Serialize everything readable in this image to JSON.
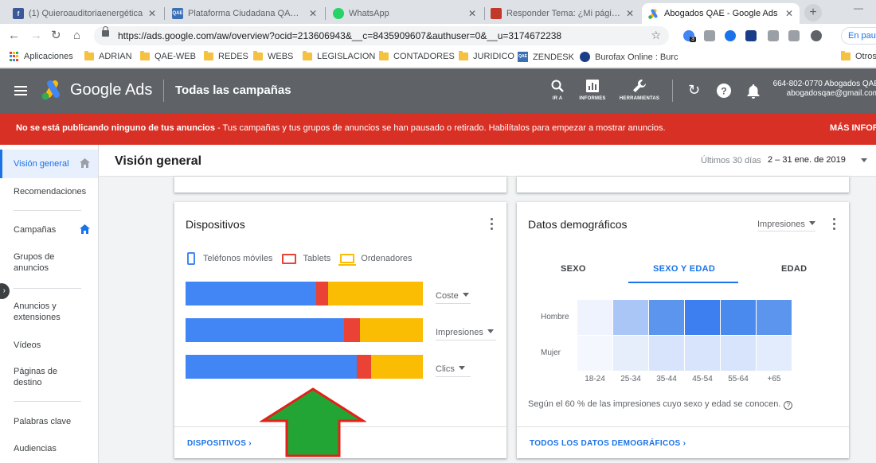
{
  "browser": {
    "tabs": [
      {
        "title": "(1) Quieroauditoriaenergética",
        "favicon_color": "#3b5998",
        "favicon_text": "f",
        "active": false
      },
      {
        "title": "Plataforma Ciudadana QAE - Ag",
        "favicon_color": "#3b6fb6",
        "favicon_text": "QAE",
        "active": false
      },
      {
        "title": "WhatsApp",
        "favicon_color": "#25d366",
        "favicon_text": "",
        "active": false
      },
      {
        "title": "Responder Tema: ¿Mi página no",
        "favicon_color": "#c0392b",
        "favicon_text": "",
        "active": false
      },
      {
        "title": "Abogados QAE - Google Ads",
        "favicon_color": "#fbbc04",
        "favicon_text": "",
        "active": true
      }
    ],
    "url": "https://ads.google.com/aw/overview?ocid=213606943&__c=8435909607&authuser=0&__u=3174672238",
    "profile_text": "En paus",
    "extension_badge": "3",
    "bookmarks": [
      {
        "label": "Aplicaciones",
        "kind": "apps"
      },
      {
        "label": "ADRIAN",
        "kind": "folder"
      },
      {
        "label": "QAE-WEB",
        "kind": "folder"
      },
      {
        "label": "REDES",
        "kind": "folder"
      },
      {
        "label": "WEBS",
        "kind": "folder"
      },
      {
        "label": "LEGISLACION",
        "kind": "folder"
      },
      {
        "label": "CONTADORES",
        "kind": "folder"
      },
      {
        "label": "JURIDICO",
        "kind": "folder"
      },
      {
        "label": "ZENDESK",
        "kind": "qae"
      },
      {
        "label": "Burofax Online : Burc",
        "kind": "search"
      },
      {
        "label": "Otros",
        "kind": "folder"
      }
    ]
  },
  "ads_header": {
    "brand": "Google Ads",
    "title": "Todas las campañas",
    "tools": [
      {
        "label": "IR A",
        "icon": "search-icon"
      },
      {
        "label": "INFORMES",
        "icon": "reports-icon"
      },
      {
        "label": "HERRAMIENTAS",
        "icon": "wrench-icon"
      }
    ],
    "account_id": "664-802-0770 Abogados QAE",
    "account_email": "abogadosqae@gmail.com"
  },
  "banner": {
    "bold": "No se está publicando ninguno de tus anuncios",
    "rest": " - Tus campañas y tus grupos de anuncios se han pausado o retirado. Habilítalos para empezar a mostrar anuncios.",
    "more": "MÁS INFOR"
  },
  "sidebar": {
    "items": [
      {
        "label": "Visión general",
        "active": true
      },
      {
        "label": "Recomendaciones",
        "active": false
      },
      {
        "label": "Campañas",
        "active": false
      },
      {
        "label": "Grupos de anuncios",
        "active": false
      },
      {
        "label": "Anuncios y extensiones",
        "active": false
      },
      {
        "label": "Vídeos",
        "active": false
      },
      {
        "label": "Páginas de destino",
        "active": false
      },
      {
        "label": "Palabras clave",
        "active": false
      },
      {
        "label": "Audiencias",
        "active": false
      }
    ]
  },
  "main": {
    "title": "Visión general",
    "date_prefix": "Últimos 30 días",
    "date_range": "2 – 31 ene. de 2019"
  },
  "devices_card": {
    "title": "Dispositivos",
    "legend": [
      "Teléfonos móviles",
      "Tablets",
      "Ordenadores"
    ],
    "colors": {
      "mobile": "#4285f4",
      "tablet": "#ea4335",
      "desktop": "#fbbc04"
    },
    "rows": [
      {
        "metric": "Coste",
        "mobile": 55.1,
        "tablet": 5.0,
        "desktop": 39.9
      },
      {
        "metric": "Impresiones",
        "mobile": 66.8,
        "tablet": 6.7,
        "desktop": 26.5
      },
      {
        "metric": "Clics",
        "mobile": 72.1,
        "tablet": 6.0,
        "desktop": 21.9
      }
    ],
    "footer_link": "DISPOSITIVOS"
  },
  "demographics_card": {
    "title": "Datos demográficos",
    "metric": "Impresiones",
    "tabs": [
      "SEXO",
      "SEXO Y EDAD",
      "EDAD"
    ],
    "active_tab": 1,
    "row_labels": [
      "Hombre",
      "Mujer"
    ],
    "age_labels": [
      "18-24",
      "25-34",
      "35-44",
      "45-54",
      "55-64",
      "+65"
    ],
    "heatmap_colors": [
      [
        "#eef3fd",
        "#a9c6f7",
        "#5b95ee",
        "#3d7ff0",
        "#4a8aef",
        "#5b95ee"
      ],
      [
        "#f4f7fe",
        "#e6eefc",
        "#d7e4fb",
        "#d7e4fb",
        "#d7e4fb",
        "#e3ecfc"
      ]
    ],
    "note": "Según el 60 % de las impresiones cuyo sexo y edad se conocen.",
    "footer_link": "TODOS LOS DATOS DEMOGRÁFICOS"
  }
}
